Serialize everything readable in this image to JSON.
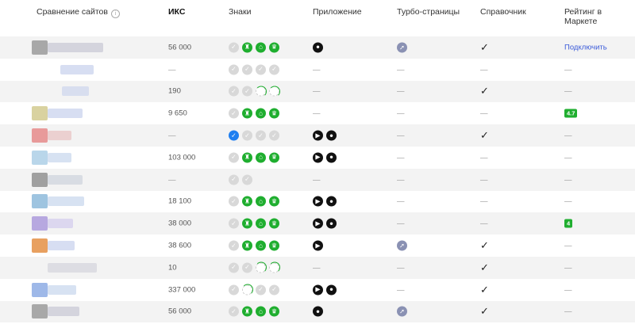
{
  "header": {
    "compare_label": "Сравнение сайтов",
    "iks": "ИКС",
    "signs": "Знаки",
    "app": "Приложение",
    "turbo": "Турбо-страницы",
    "directory": "Справочник",
    "market_rating": "Рейтинг в Маркете"
  },
  "dash": "—",
  "icons": {
    "info": "info-icon",
    "check": "check-icon",
    "apple": "apple-icon",
    "play": "google-play-icon",
    "turbo": "rocket-icon",
    "badge_ok": "check-badge-icon",
    "badge_lock": "secure-badge-icon",
    "badge_popular": "crown-badge-icon"
  },
  "colors": {
    "green": "#1fae2f",
    "link": "#3a5ad9",
    "turbo": "#8a91b3",
    "verified": "#1f7ff0"
  },
  "rows": [
    {
      "iks": "56 000",
      "signs": [
        "gray",
        "green",
        "green",
        "green"
      ],
      "app": [
        "apple"
      ],
      "turbo": true,
      "directory": true,
      "market": "Подключить",
      "market_type": "link",
      "logo": "#a8a8a8",
      "name_color": "#c9c9d6",
      "name_w": 70,
      "indent": 0
    },
    {
      "iks": "—",
      "signs": [
        "gray",
        "gray",
        "gray",
        "gray"
      ],
      "app": [],
      "turbo": false,
      "directory": false,
      "market": "—",
      "market_type": "dash",
      "logo": "",
      "name_color": "#c9d3ee",
      "name_w": 42,
      "indent": 16
    },
    {
      "iks": "190",
      "signs": [
        "gray",
        "gray",
        "ring",
        "ring"
      ],
      "app": [],
      "turbo": false,
      "directory": true,
      "market": "—",
      "market_type": "dash",
      "logo": "",
      "name_color": "#cfd7ee",
      "name_w": 34,
      "indent": 18
    },
    {
      "iks": "9 650",
      "signs": [
        "gray",
        "green",
        "green",
        "green"
      ],
      "app": [],
      "turbo": false,
      "directory": false,
      "market": "4.7",
      "market_type": "badge",
      "logo": "#d9d2a0",
      "name_color": "#c9d3ee",
      "name_w": 44,
      "indent": 0
    },
    {
      "iks": "—",
      "signs": [
        "blue",
        "gray",
        "gray",
        "gray"
      ],
      "app": [
        "play",
        "apple"
      ],
      "turbo": false,
      "directory": true,
      "market": "—",
      "market_type": "dash",
      "logo": "#e89a9a",
      "name_color": "#e8c4c4",
      "name_w": 30,
      "indent": 0
    },
    {
      "iks": "103 000",
      "signs": [
        "gray",
        "green",
        "green",
        "green"
      ],
      "app": [
        "play",
        "apple"
      ],
      "turbo": false,
      "directory": false,
      "market": "—",
      "market_type": "dash",
      "logo": "#b9d6ea",
      "name_color": "#c9d8ee",
      "name_w": 30,
      "indent": 0
    },
    {
      "iks": "—",
      "signs": [
        "gray",
        "gray"
      ],
      "app": [],
      "turbo": false,
      "directory": false,
      "market": "—",
      "market_type": "dash",
      "logo": "#a0a0a0",
      "name_color": "#cfd4dd",
      "name_w": 44,
      "indent": 0
    },
    {
      "iks": "18 100",
      "signs": [
        "gray",
        "green",
        "green",
        "green"
      ],
      "app": [
        "play",
        "apple"
      ],
      "turbo": false,
      "directory": false,
      "market": "—",
      "market_type": "dash",
      "logo": "#9ec4e0",
      "name_color": "#c9d8ee",
      "name_w": 46,
      "indent": 0
    },
    {
      "iks": "38 000",
      "signs": [
        "gray",
        "green",
        "green",
        "green"
      ],
      "app": [
        "play",
        "apple"
      ],
      "turbo": false,
      "directory": false,
      "market": "4",
      "market_type": "badge",
      "logo": "#b7a8e0",
      "name_color": "#d4cdee",
      "name_w": 32,
      "indent": 0
    },
    {
      "iks": "38 600",
      "signs": [
        "gray",
        "green",
        "green",
        "green"
      ],
      "app": [
        "play"
      ],
      "turbo": true,
      "directory": true,
      "market": "—",
      "market_type": "dash",
      "logo": "#e8a060",
      "name_color": "#c9d3ee",
      "name_w": 34,
      "indent": 0
    },
    {
      "iks": "10",
      "signs": [
        "gray",
        "gray",
        "ring",
        "ring"
      ],
      "app": [],
      "turbo": false,
      "directory": true,
      "market": "—",
      "market_type": "dash",
      "logo": "",
      "name_color": "#d6d6dd",
      "name_w": 62,
      "indent": 0
    },
    {
      "iks": "337 000",
      "signs": [
        "gray",
        "ring",
        "gray",
        "gray"
      ],
      "app": [
        "play",
        "apple"
      ],
      "turbo": false,
      "directory": true,
      "market": "—",
      "market_type": "dash",
      "logo": "#9eb8e8",
      "name_color": "#c9d8ee",
      "name_w": 36,
      "indent": 0
    },
    {
      "iks": "56 000",
      "signs": [
        "gray",
        "green",
        "green",
        "green"
      ],
      "app": [
        "apple"
      ],
      "turbo": true,
      "directory": true,
      "market": "—",
      "market_type": "dash",
      "logo": "#a8a8a8",
      "name_color": "#c9c9d6",
      "name_w": 40,
      "indent": 0
    }
  ]
}
